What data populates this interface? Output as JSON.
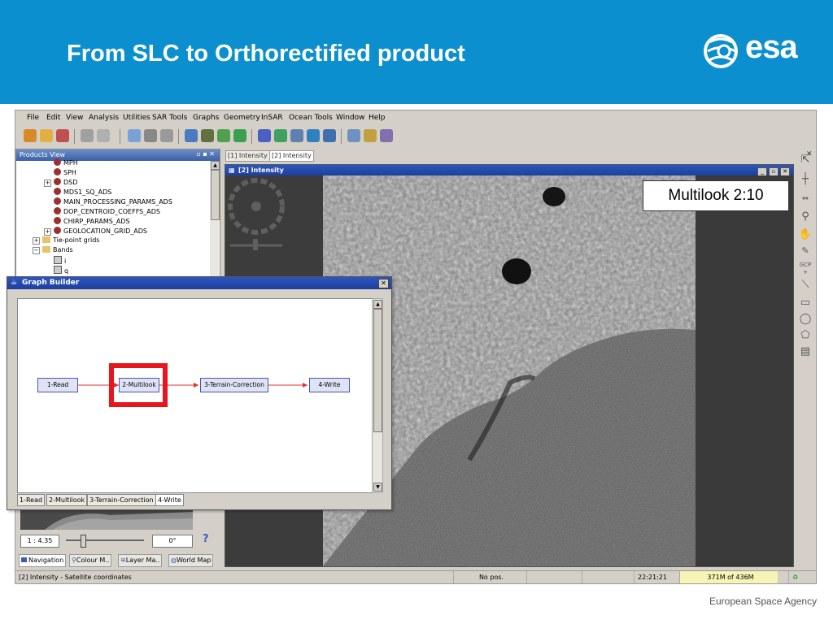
{
  "slide": {
    "title": "From SLC to Orthorectified product",
    "logo_text": "esa",
    "footer": "European Space Agency"
  },
  "menu": [
    "File",
    "Edit",
    "View",
    "Analysis",
    "Utilities",
    "SAR Tools",
    "Graphs",
    "Geometry",
    "InSAR",
    "Ocean Tools",
    "Window",
    "Help"
  ],
  "products_view": {
    "title": "Products View",
    "tree": [
      {
        "label": "MPH",
        "kind": "meta"
      },
      {
        "label": "SPH",
        "kind": "meta"
      },
      {
        "label": "DSD",
        "kind": "meta"
      },
      {
        "label": "MDS1_SQ_ADS",
        "kind": "meta"
      },
      {
        "label": "MAIN_PROCESSING_PARAMS_ADS",
        "kind": "meta"
      },
      {
        "label": "DOP_CENTROID_COEFFS_ADS",
        "kind": "meta"
      },
      {
        "label": "CHIRP_PARAMS_ADS",
        "kind": "meta"
      },
      {
        "label": "GEOLOCATION_GRID_ADS",
        "kind": "meta"
      },
      {
        "label": "Tie-point grids",
        "kind": "folder"
      },
      {
        "label": "Bands",
        "kind": "folder"
      },
      {
        "label": "i",
        "kind": "band"
      },
      {
        "label": "q",
        "kind": "band"
      }
    ]
  },
  "image_view": {
    "tabs": [
      "[1] Intensity",
      "[2] Intensity"
    ],
    "window_title": "[2] Intensity"
  },
  "annotation": "Multilook 2:10",
  "graph_builder": {
    "title": "Graph Builder",
    "nodes": [
      "1-Read",
      "2-Multilook",
      "3-Terrain-Correction",
      "4-Write"
    ],
    "tabs": [
      "1-Read",
      "2-Multilook",
      "3-Terrain-Correction",
      "4-Write"
    ],
    "highlighted_node": "2-Multilook",
    "highlight_color": "#e8141e"
  },
  "navigation": {
    "zoom": "1 : 4.35",
    "angle": "0°",
    "tabs": [
      "Navigation",
      "Colour M..",
      "Layer Ma..",
      "World Map"
    ]
  },
  "status": {
    "left": "[2] Intensity - Satellite coordinates",
    "position": "No pos.",
    "time": "22:21:21",
    "memory": "371M of 436M"
  },
  "colors": {
    "header_blue": "#0b8fce",
    "title_bar_blue": "#2b56c2",
    "memory_bg": "#f6f3b4"
  }
}
